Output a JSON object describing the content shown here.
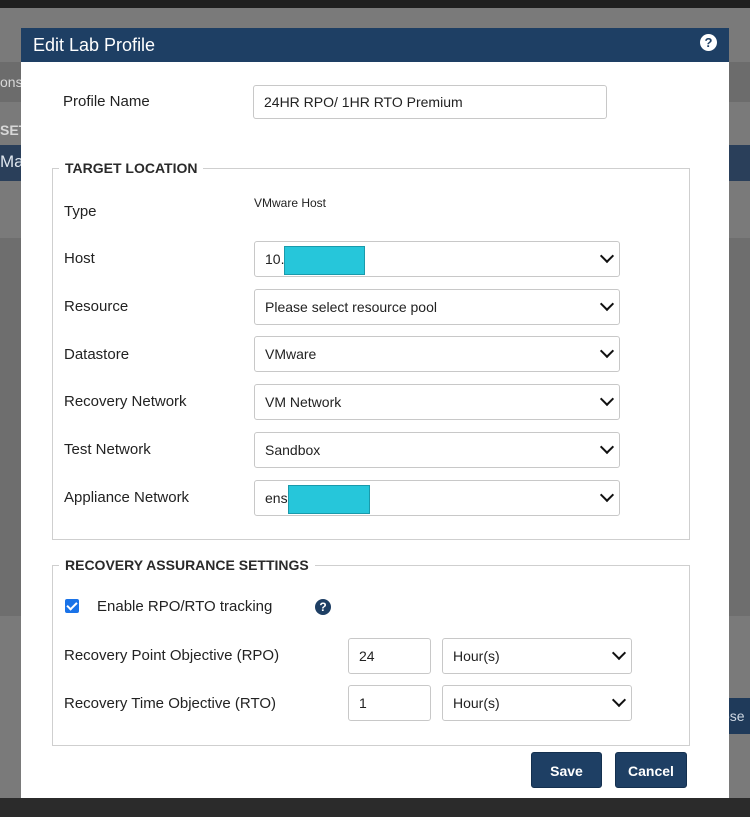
{
  "background": {
    "peek_left_1": "ons",
    "peek_left_2": "SET",
    "peek_left_3": "Mar",
    "close_peek": "ose"
  },
  "modal": {
    "title": "Edit Lab Profile",
    "help_glyph": "?",
    "profile_name_label": "Profile Name",
    "profile_name_value": "24HR RPO/ 1HR RTO Premium"
  },
  "target_location": {
    "legend": "TARGET LOCATION",
    "type_label": "Type",
    "type_value": "VMware Host",
    "host_label": "Host",
    "host_value": "10.",
    "resource_label": "Resource",
    "resource_value": "Please select resource pool",
    "datastore_label": "Datastore",
    "datastore_value": "VMware",
    "recovery_network_label": "Recovery Network",
    "recovery_network_value": "VM Network",
    "test_network_label": "Test Network",
    "test_network_value": "Sandbox",
    "appliance_network_label": "Appliance Network",
    "appliance_network_value": "ens"
  },
  "recovery_assurance": {
    "legend": "RECOVERY ASSURANCE SETTINGS",
    "enable_label": "Enable RPO/RTO tracking",
    "enable_checked": true,
    "help_glyph": "?",
    "rpo_label": "Recovery Point Objective (RPO)",
    "rpo_value": "24",
    "rpo_unit": "Hour(s)",
    "rto_label": "Recovery Time Objective (RTO)",
    "rto_value": "1",
    "rto_unit": "Hour(s)"
  },
  "actions": {
    "save_label": "Save",
    "cancel_label": "Cancel"
  },
  "colors": {
    "header": "#1e3f64",
    "redaction": "#26c6da",
    "checkbox": "#1a73e8"
  }
}
